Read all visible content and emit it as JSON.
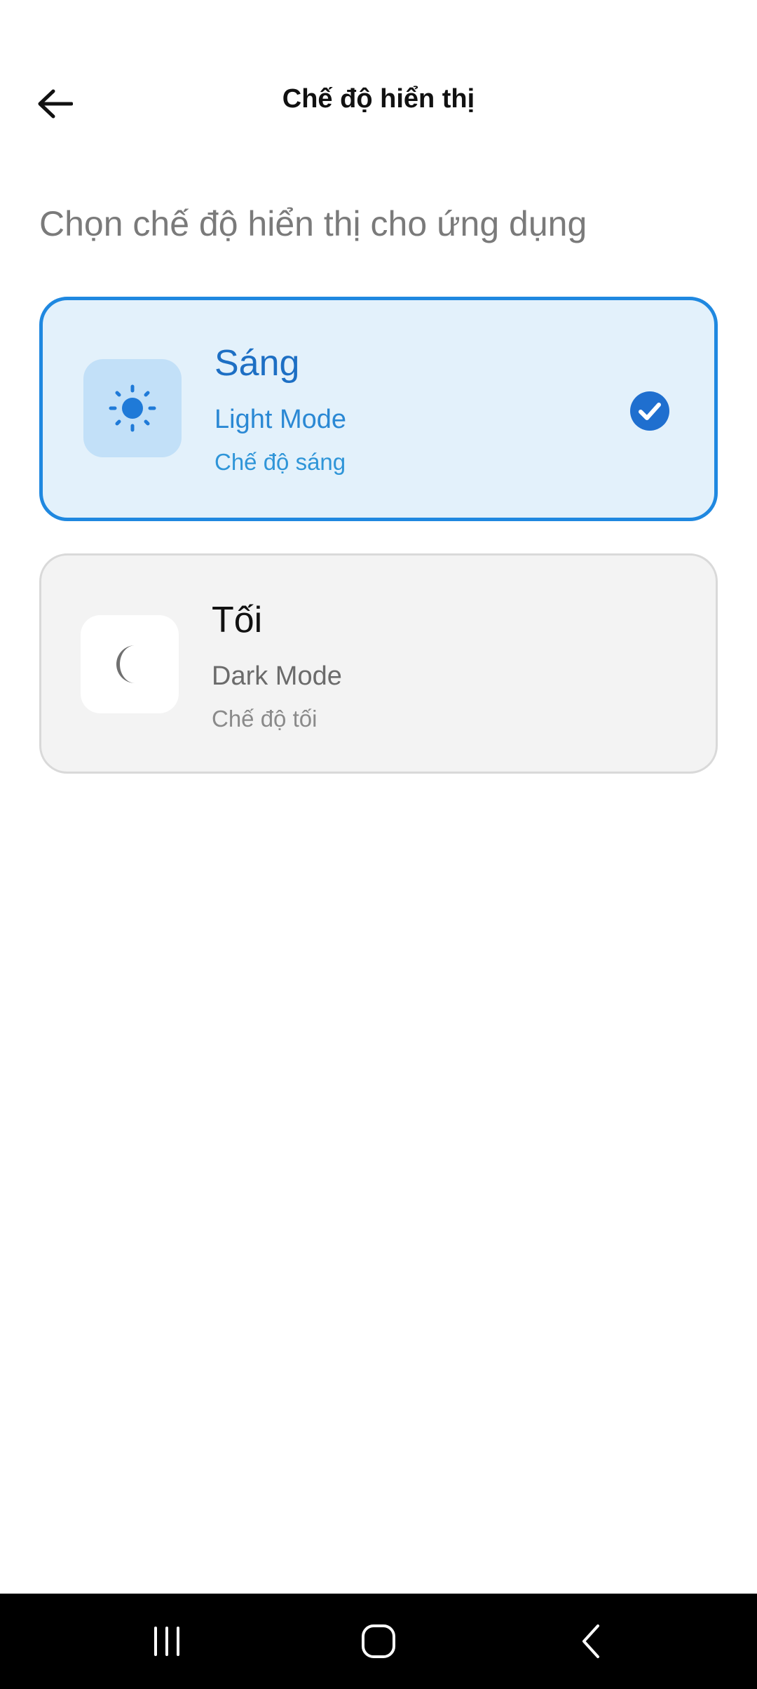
{
  "header": {
    "title": "Chế độ hiển thị",
    "back_icon": "arrow-left-icon"
  },
  "subtitle": "Chọn chế độ hiển thị cho ứng dụng",
  "options": [
    {
      "title": "Sáng",
      "english": "Light Mode",
      "vietnamese": "Chế độ sáng",
      "icon": "sun-icon",
      "selected": true
    },
    {
      "title": "Tối",
      "english": "Dark Mode",
      "vietnamese": "Chế độ tối",
      "icon": "moon-icon",
      "selected": false
    }
  ],
  "colors": {
    "accent": "#1f88e0",
    "selected_card_bg": "#e3f1fb",
    "unselected_card_bg": "#f3f3f3"
  },
  "system_nav": {
    "recent_icon": "recent-apps-icon",
    "home_icon": "home-icon",
    "back_icon": "nav-back-icon"
  }
}
